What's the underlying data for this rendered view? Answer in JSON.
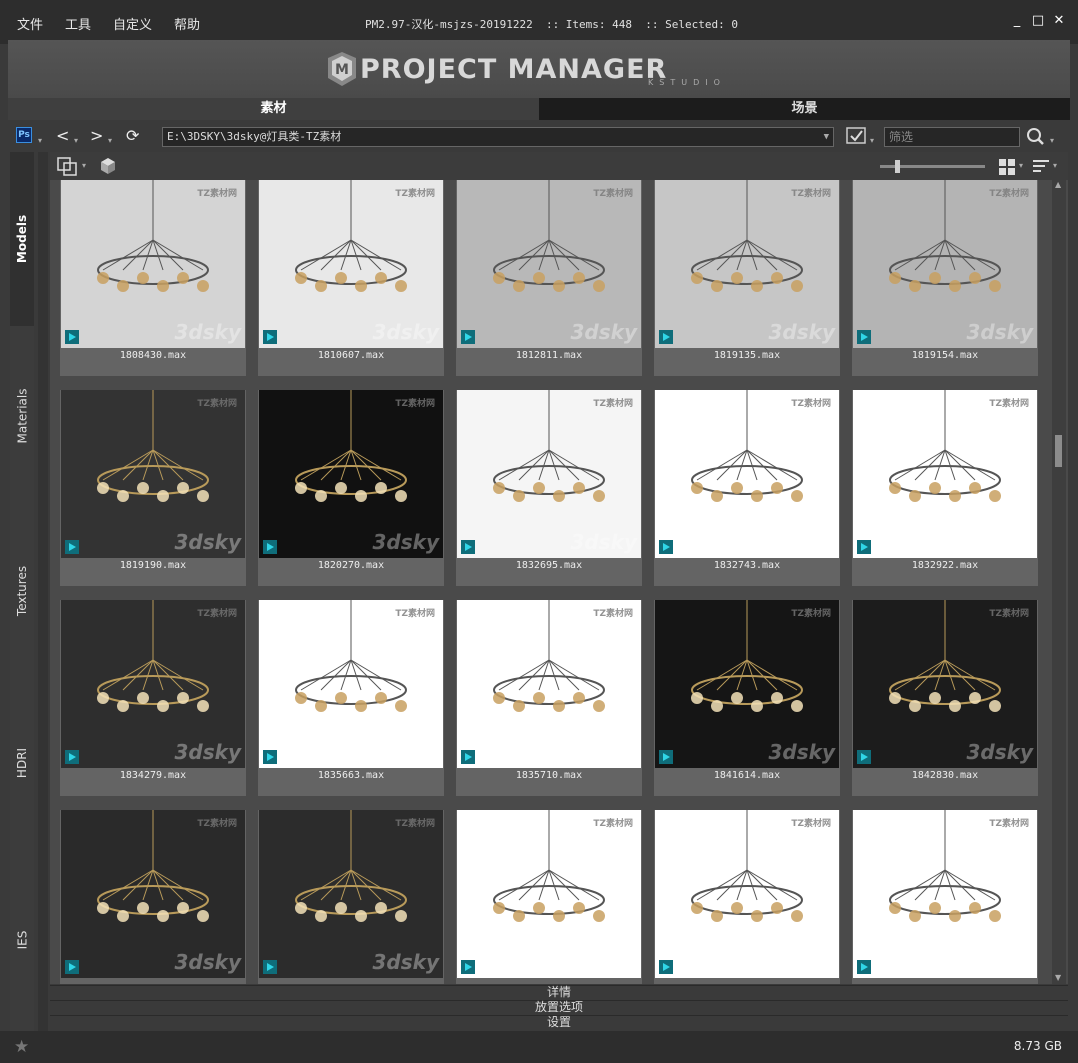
{
  "menu": [
    "文件",
    "工具",
    "自定义",
    "帮助"
  ],
  "title_info": "PM2.97-汉化-msjzs-20191222  :: Items: 448  :: Selected: 0",
  "window_buttons": {
    "minimize": "_",
    "maximize": "□",
    "close": "✕"
  },
  "banner": {
    "logo_text": "PROJECT MANAGER",
    "logo_sub": "KSTUDIO"
  },
  "tabs": [
    {
      "label": "素材",
      "active": true
    },
    {
      "label": "场景",
      "active": false
    }
  ],
  "toolbar": {
    "ps_label": "Ps",
    "back": "<",
    "forward": ">",
    "refresh": "⟳",
    "path": "E:\\3DSKY\\3dsky@灯具类-TZ素材",
    "filter_placeholder": "筛选"
  },
  "sidebar_tabs": [
    {
      "label": "Models",
      "active": true
    },
    {
      "label": "Materials",
      "active": false
    },
    {
      "label": "Textures",
      "active": false
    },
    {
      "label": "HDRI",
      "active": false
    },
    {
      "label": "IES",
      "active": false
    }
  ],
  "items": [
    {
      "name": "1808430.max",
      "bg": "#d4d4d4",
      "tone": "light"
    },
    {
      "name": "1810607.max",
      "bg": "#e8e8e8",
      "tone": "light"
    },
    {
      "name": "1812811.max",
      "bg": "#b8b8b8",
      "tone": "mid"
    },
    {
      "name": "1819135.max",
      "bg": "#c6c6c6",
      "tone": "mid"
    },
    {
      "name": "1819154.max",
      "bg": "#b4b4b4",
      "tone": "mid"
    },
    {
      "name": "1819190.max",
      "bg": "#333333",
      "tone": "dark"
    },
    {
      "name": "1820270.max",
      "bg": "#111111",
      "tone": "dark"
    },
    {
      "name": "1832695.max",
      "bg": "#f5f5f5",
      "tone": "light"
    },
    {
      "name": "1832743.max",
      "bg": "#ffffff",
      "tone": "light"
    },
    {
      "name": "1832922.max",
      "bg": "#ffffff",
      "tone": "light"
    },
    {
      "name": "1834279.max",
      "bg": "#2e2e2e",
      "tone": "dark"
    },
    {
      "name": "1835663.max",
      "bg": "#ffffff",
      "tone": "light"
    },
    {
      "name": "1835710.max",
      "bg": "#ffffff",
      "tone": "light"
    },
    {
      "name": "1841614.max",
      "bg": "#151515",
      "tone": "dark"
    },
    {
      "name": "1842830.max",
      "bg": "#1c1c1c",
      "tone": "dark"
    },
    {
      "name": "",
      "bg": "#2a2a2a",
      "tone": "dark"
    },
    {
      "name": "",
      "bg": "#2c2c2c",
      "tone": "dark"
    },
    {
      "name": "",
      "bg": "#ffffff",
      "tone": "light"
    },
    {
      "name": "",
      "bg": "#ffffff",
      "tone": "light"
    },
    {
      "name": "",
      "bg": "#ffffff",
      "tone": "light"
    }
  ],
  "watermark": "3dsky",
  "tz_mark": "TZ素材网",
  "panels": [
    "详情",
    "放置选项",
    "设置"
  ],
  "status": {
    "size": "8.73 GB",
    "star": "★"
  }
}
